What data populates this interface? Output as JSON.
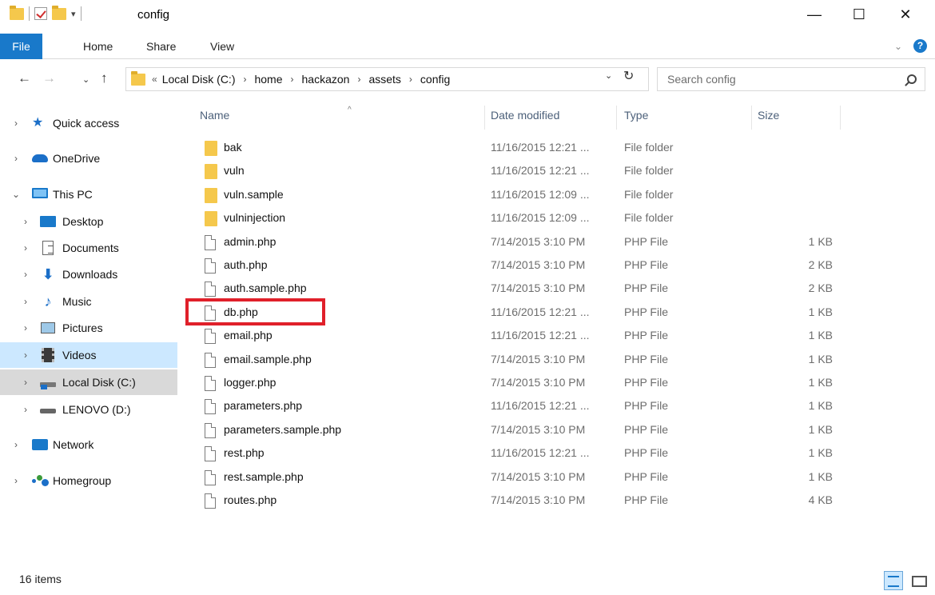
{
  "window": {
    "title": "config",
    "minimize_label": "—",
    "maximize_label": "☐",
    "close_label": "✕"
  },
  "ribbon": {
    "tabs": [
      "File",
      "Home",
      "Share",
      "View"
    ]
  },
  "address": {
    "overflow": "«",
    "crumbs": [
      "Local Disk (C:)",
      "home",
      "hackazon",
      "assets",
      "config"
    ]
  },
  "search": {
    "placeholder": "Search config"
  },
  "nav": {
    "items": [
      {
        "label": "Quick access",
        "icon": "star-icon"
      },
      {
        "label": "OneDrive",
        "icon": "cloud-icon"
      },
      {
        "label": "This PC",
        "icon": "computer-icon"
      },
      {
        "label": "Desktop",
        "icon": "desktop-icon"
      },
      {
        "label": "Documents",
        "icon": "documents-icon"
      },
      {
        "label": "Downloads",
        "icon": "download-icon"
      },
      {
        "label": "Music",
        "icon": "music-icon"
      },
      {
        "label": "Pictures",
        "icon": "pictures-icon"
      },
      {
        "label": "Videos",
        "icon": "video-icon"
      },
      {
        "label": "Local Disk (C:)",
        "icon": "local-disk-icon"
      },
      {
        "label": "LENOVO (D:)",
        "icon": "drive-icon"
      },
      {
        "label": "Network",
        "icon": "network-icon"
      },
      {
        "label": "Homegroup",
        "icon": "homegroup-icon"
      }
    ]
  },
  "columns": {
    "name": "Name",
    "date": "Date modified",
    "type": "Type",
    "size": "Size"
  },
  "files": [
    {
      "name": "bak",
      "date": "11/16/2015 12:21 ...",
      "type": "File folder",
      "size": "",
      "kind": "folder"
    },
    {
      "name": "vuln",
      "date": "11/16/2015 12:21 ...",
      "type": "File folder",
      "size": "",
      "kind": "folder"
    },
    {
      "name": "vuln.sample",
      "date": "11/16/2015 12:09 ...",
      "type": "File folder",
      "size": "",
      "kind": "folder"
    },
    {
      "name": "vulninjection",
      "date": "11/16/2015 12:09 ...",
      "type": "File folder",
      "size": "",
      "kind": "folder"
    },
    {
      "name": "admin.php",
      "date": "7/14/2015 3:10 PM",
      "type": "PHP File",
      "size": "1 KB",
      "kind": "file"
    },
    {
      "name": "auth.php",
      "date": "7/14/2015 3:10 PM",
      "type": "PHP File",
      "size": "2 KB",
      "kind": "file"
    },
    {
      "name": "auth.sample.php",
      "date": "7/14/2015 3:10 PM",
      "type": "PHP File",
      "size": "2 KB",
      "kind": "file"
    },
    {
      "name": "db.php",
      "date": "11/16/2015 12:21 ...",
      "type": "PHP File",
      "size": "1 KB",
      "kind": "file"
    },
    {
      "name": "email.php",
      "date": "11/16/2015 12:21 ...",
      "type": "PHP File",
      "size": "1 KB",
      "kind": "file"
    },
    {
      "name": "email.sample.php",
      "date": "7/14/2015 3:10 PM",
      "type": "PHP File",
      "size": "1 KB",
      "kind": "file"
    },
    {
      "name": "logger.php",
      "date": "7/14/2015 3:10 PM",
      "type": "PHP File",
      "size": "1 KB",
      "kind": "file"
    },
    {
      "name": "parameters.php",
      "date": "11/16/2015 12:21 ...",
      "type": "PHP File",
      "size": "1 KB",
      "kind": "file"
    },
    {
      "name": "parameters.sample.php",
      "date": "7/14/2015 3:10 PM",
      "type": "PHP File",
      "size": "1 KB",
      "kind": "file"
    },
    {
      "name": "rest.php",
      "date": "11/16/2015 12:21 ...",
      "type": "PHP File",
      "size": "1 KB",
      "kind": "file"
    },
    {
      "name": "rest.sample.php",
      "date": "7/14/2015 3:10 PM",
      "type": "PHP File",
      "size": "1 KB",
      "kind": "file"
    },
    {
      "name": "routes.php",
      "date": "7/14/2015 3:10 PM",
      "type": "PHP File",
      "size": "4 KB",
      "kind": "file"
    }
  ],
  "status": {
    "item_count": "16 items"
  },
  "colors": {
    "accent": "#1979ca",
    "selection": "#cce8ff",
    "highlight_box": "#e0202a"
  }
}
